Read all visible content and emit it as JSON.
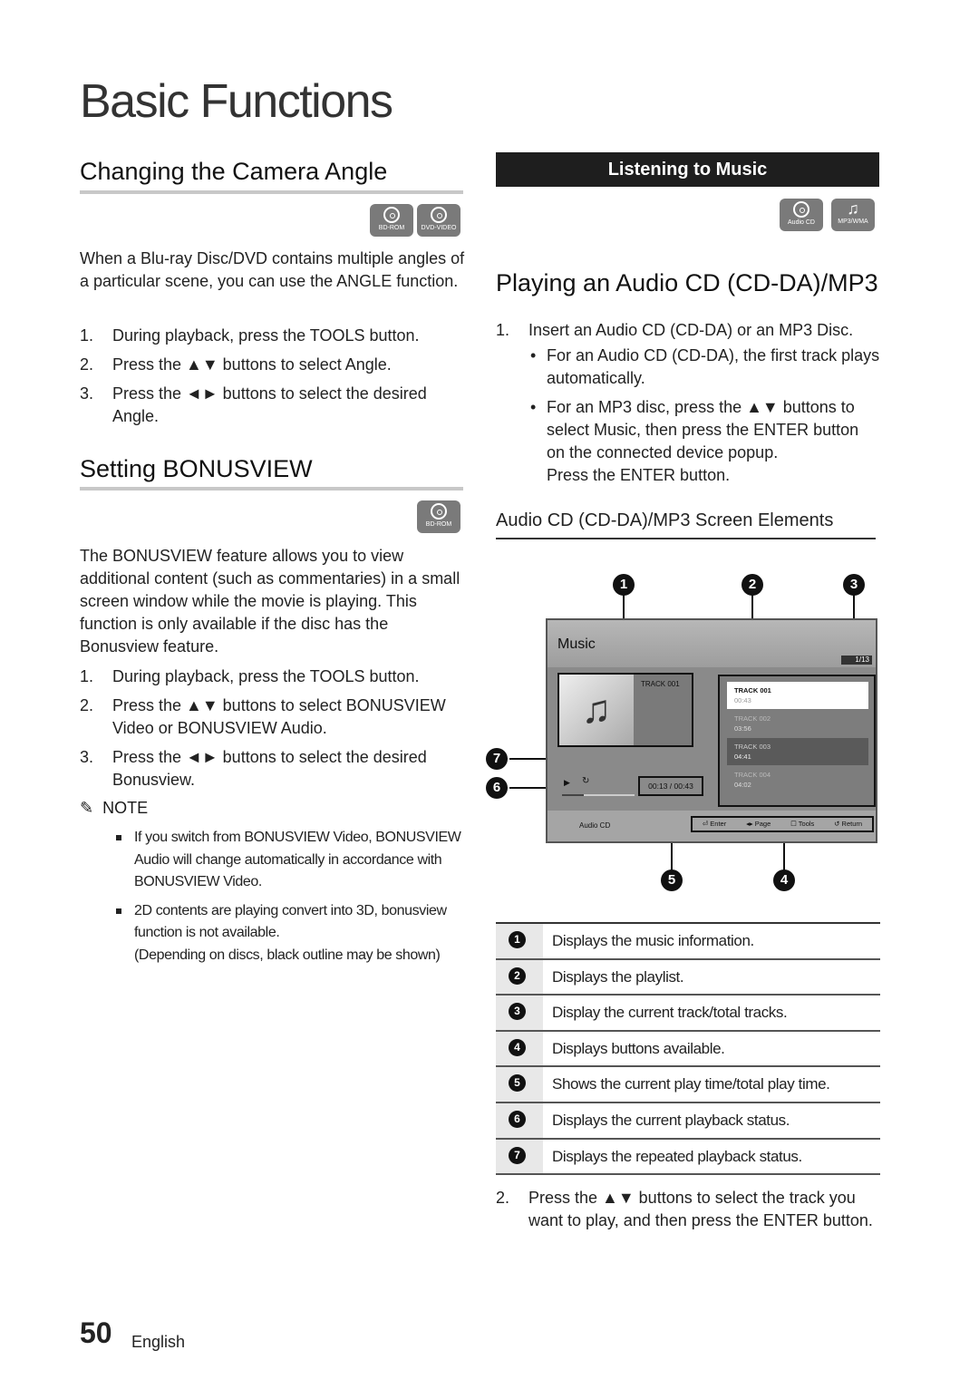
{
  "page_title": "Basic Functions",
  "left": {
    "camera_angle": {
      "heading": "Changing the Camera Angle",
      "badges": [
        "BD-ROM",
        "DVD-VIDEO"
      ],
      "intro": "When a Blu-ray Disc/DVD contains multiple angles of a particular scene, you can use the ANGLE function.",
      "steps": [
        {
          "num": "1.",
          "text": "During playback, press the TOOLS button."
        },
        {
          "num": "2.",
          "text": "Press the ▲▼ buttons to select Angle."
        },
        {
          "num": "3.",
          "text": "Press the ◄► buttons to select the desired Angle."
        }
      ]
    },
    "bonusview": {
      "heading": "Setting BONUSVIEW",
      "badges": [
        "BD-ROM"
      ],
      "intro": "The BONUSVIEW feature allows you to view additional content (such as commentaries) in a small screen window while the movie is playing. This function is only available if the disc has the Bonusview feature.",
      "steps": [
        {
          "num": "1.",
          "text": "During playback, press the TOOLS button."
        },
        {
          "num": "2.",
          "text": "Press the ▲▼ buttons to select BONUSVIEW Video or BONUSVIEW Audio."
        },
        {
          "num": "3.",
          "text": "Press the ◄► buttons to select the desired Bonusview."
        }
      ],
      "note_label": "NOTE",
      "notes": [
        "If you switch from BONUSVIEW Video, BONUSVIEW Audio will change automatically in accordance with BONUSVIEW Video.",
        "2D contents are playing convert into 3D, bonusview function is not available."
      ],
      "note_extra": "(Depending on discs, black outline may be shown)"
    }
  },
  "right": {
    "banner": "Listening to Music",
    "badges": [
      "Audio CD",
      "MP3/WMA"
    ],
    "heading": "Playing an Audio CD (CD-DA)/MP3",
    "step1": {
      "num": "1.",
      "text": "Insert an Audio CD (CD-DA) or an MP3 Disc."
    },
    "bullets": [
      "For an Audio CD (CD-DA), the first track plays automatically.",
      "For an MP3 disc, press the ▲▼ buttons to select Music, then press the ENTER button on the connected device popup."
    ],
    "bullet_extra": "Press the ENTER button.",
    "subheading": "Audio CD (CD-DA)/MP3 Screen Elements",
    "screen": {
      "title": "Music",
      "track_counter": "1/13",
      "current_track": "TRACK 001",
      "time": "00:13 / 00:43",
      "progress": 0.3,
      "source": "Audio CD",
      "playlist": [
        {
          "name": "TRACK 001",
          "time": "00:43"
        },
        {
          "name": "TRACK 002",
          "time": "03:56"
        },
        {
          "name": "TRACK 003",
          "time": "04:41"
        },
        {
          "name": "TRACK 004",
          "time": "04:02"
        }
      ],
      "buttons": [
        "Enter",
        "Page",
        "Tools",
        "Return"
      ]
    },
    "callouts": [
      "1",
      "2",
      "3",
      "4",
      "5",
      "6",
      "7"
    ],
    "table": [
      {
        "num": "1",
        "text": "Displays the music information."
      },
      {
        "num": "2",
        "text": "Displays the playlist."
      },
      {
        "num": "3",
        "text": "Display the current track/total tracks."
      },
      {
        "num": "4",
        "text": "Displays buttons available."
      },
      {
        "num": "5",
        "text": "Shows the current play time/total play time."
      },
      {
        "num": "6",
        "text": "Displays the current playback status."
      },
      {
        "num": "7",
        "text": "Displays the repeated playback status."
      }
    ],
    "step2": {
      "num": "2.",
      "text": "Press the ▲▼ buttons to select the track you want to play, and then press the ENTER button."
    }
  },
  "footer": {
    "page_number": "50",
    "language": "English"
  }
}
